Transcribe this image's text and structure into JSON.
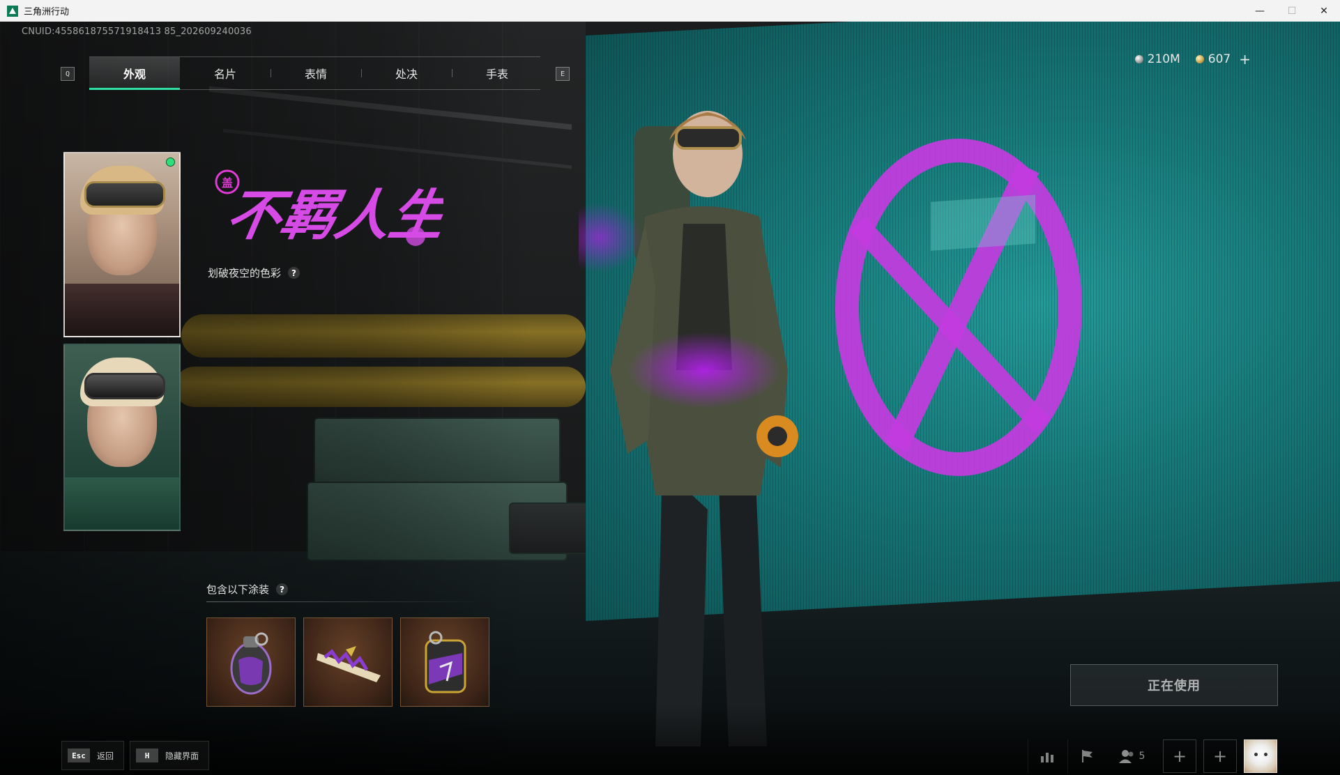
{
  "window": {
    "title": "三角洲行动"
  },
  "uid_text": "CN UID:4558618755719184138 5_202609240036",
  "tabs": {
    "prev_key": "Q",
    "next_key": "E",
    "items": [
      {
        "label": "外观",
        "active": true
      },
      {
        "label": "名片",
        "active": false
      },
      {
        "label": "表情",
        "active": false
      },
      {
        "label": "处决",
        "active": false
      },
      {
        "label": "手表",
        "active": false
      }
    ]
  },
  "currency": {
    "silver": "210M",
    "gold": "607",
    "add": "+"
  },
  "skin": {
    "logo_text": "不羁人生",
    "subtitle": "划破夜空的色彩",
    "help": "?"
  },
  "includes": {
    "label": "包含以下涂装",
    "help": "?",
    "items": [
      {
        "icon": "grenade-skin-icon"
      },
      {
        "icon": "knife-skin-icon"
      },
      {
        "icon": "backpack-skin-icon"
      }
    ]
  },
  "action_button": "正在使用",
  "bottom_left": {
    "back_key": "Esc",
    "back_label": "返回",
    "hide_key": "H",
    "hide_label": "隐藏界面"
  },
  "bottom_right": {
    "party_count": "5",
    "add": "+"
  },
  "colors": {
    "accent": "#2fe0a4",
    "neon_purple": "#c43be0",
    "screen_teal": "#1f9c9a"
  }
}
